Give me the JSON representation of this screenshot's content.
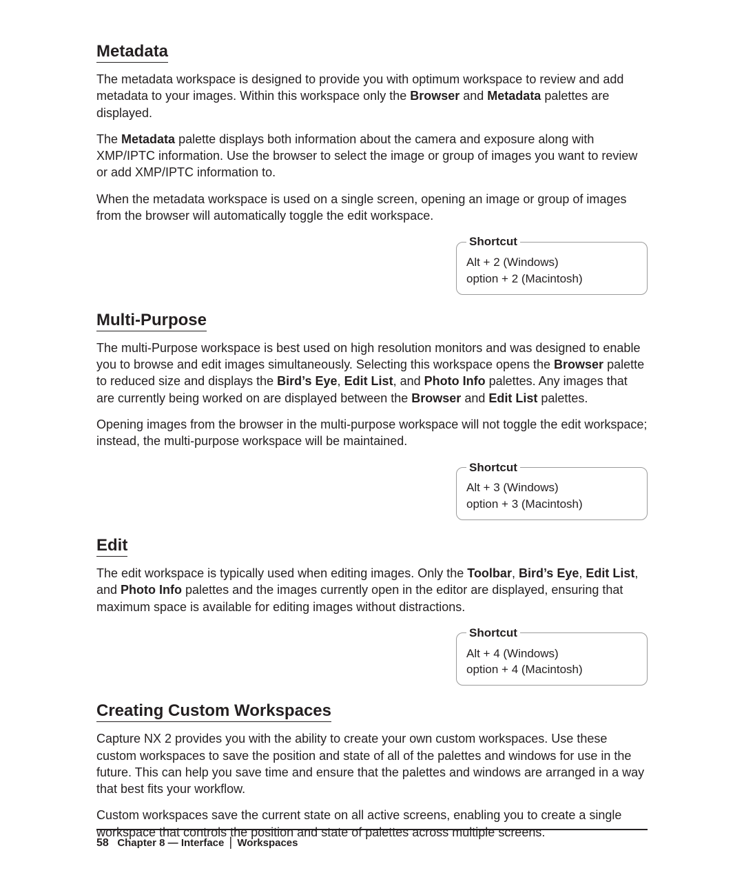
{
  "sections": {
    "metadata": {
      "title": "Metadata",
      "p1_a": "The metadata workspace is designed to provide you with optimum workspace to review and add metadata to your images. Within this workspace only the ",
      "p1_b1": "Browser",
      "p1_c": " and ",
      "p1_b2": "Metadata",
      "p1_d": " palettes are displayed.",
      "p2_a": "The ",
      "p2_b1": "Metadata",
      "p2_c": " palette displays both information about the camera and exposure along with XMP/IPTC information. Use the browser to select the image or group of images you want to review or add XMP/IPTC information to.",
      "p3": "When the metadata workspace is used on a single screen, opening an image or group of images from the browser will automatically toggle the edit workspace.",
      "shortcut": {
        "label": "Shortcut",
        "l1": "Alt + 2 (Windows)",
        "l2": "option + 2 (Macintosh)"
      }
    },
    "multipurpose": {
      "title": "Multi-Purpose",
      "p1_a": "The multi-Purpose workspace is best used on high resolution monitors and was designed to enable you to browse and edit images simultaneously. Selecting this workspace opens the ",
      "p1_b1": "Browser",
      "p1_c": " palette to reduced size and displays the ",
      "p1_b2": "Bird’s Eye",
      "p1_d": ", ",
      "p1_b3": "Edit List",
      "p1_e": ", and ",
      "p1_b4": "Photo Info",
      "p1_f": " palettes. Any images that are currently being worked on are displayed between the ",
      "p1_b5": "Browser",
      "p1_g": " and ",
      "p1_b6": "Edit List",
      "p1_h": " palettes.",
      "p2": "Opening images from the browser in the multi-purpose workspace will not toggle the edit workspace; instead, the multi-purpose workspace will be maintained.",
      "shortcut": {
        "label": "Shortcut",
        "l1": "Alt + 3 (Windows)",
        "l2": "option + 3 (Macintosh)"
      }
    },
    "edit": {
      "title": "Edit",
      "p1_a": "The edit workspace is typically used when editing images. Only the ",
      "p1_b1": "Toolbar",
      "p1_c": ", ",
      "p1_b2": "Bird’s Eye",
      "p1_d": ", ",
      "p1_b3": "Edit List",
      "p1_e": ", and ",
      "p1_b4": "Photo Info",
      "p1_f": " palettes and the images currently open in the editor are displayed, ensuring that maximum space is available for editing images without distractions.",
      "shortcut": {
        "label": "Shortcut",
        "l1": "Alt + 4 (Windows)",
        "l2": "option + 4 (Macintosh)"
      }
    },
    "custom": {
      "title": "Creating Custom Workspaces",
      "p1": "Capture NX 2 provides you with the ability to create your own custom workspaces. Use these custom workspaces to save the position and state of all of the palettes and windows for use in the future. This can help you save time and ensure that the palettes and windows are arranged in a way that best fits your workflow.",
      "p2": "Custom workspaces save the current state on all active screens, enabling you to create a single workspace that controls the position and state of palettes across multiple screens."
    }
  },
  "footer": {
    "page": "58",
    "chapter": "Chapter 8 — Interface",
    "subsection": "Workspaces"
  }
}
